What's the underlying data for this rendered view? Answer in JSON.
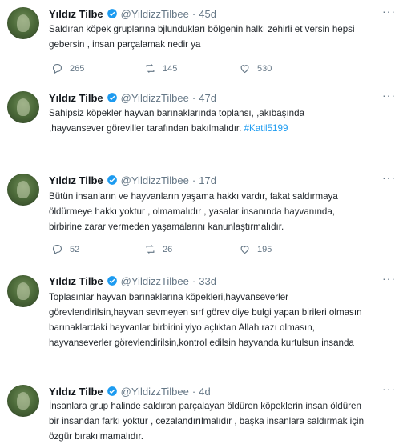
{
  "user": {
    "name": "Yıldız Tilbe",
    "handle": "@YildizzTilbee"
  },
  "tweets": [
    {
      "time": "45d",
      "lines": [
        "Saldıran köpek gruplarına bjlundukları bölgenin halkı zehirli et versin hepsi",
        "gebersin , insan parçalamak nedir ya"
      ],
      "replies": "265",
      "retweets": "145",
      "likes": "530"
    },
    {
      "time": "47d",
      "lines": [
        "Sahipsiz köpekler hayvan barınaklarında toplansı, ,akıbaşında",
        ",hayvansever göreviller tarafından bakılmalıdır."
      ],
      "hashtag": "#Katil5199"
    },
    {
      "time": "17d",
      "lines": [
        "Bütün insanların ve hayvanların yaşama hakkı vardır, fakat saldırmaya",
        "öldürmeye hakkı yoktur , olmamalıdır , yasalar insanında hayvanında,",
        "birbirine zarar vermeden yaşamalarını kanunlaştırmalıdır."
      ],
      "replies": "52",
      "retweets": "26",
      "likes": "195"
    },
    {
      "time": "33d",
      "lines": [
        "Toplasınlar hayvan barınaklarına köpekleri,hayvanseverler",
        "görevlendirilsin,hayvan sevmeyen sırf görev diye bulgi yapan birileri olmasın",
        "barınaklardaki hayvanlar birbirini yiyo açlıktan Allah razı olmasın,",
        "hayvanseverler görevlendirilsin,kontrol edilsin hayvanda kurtulsun insanda"
      ]
    },
    {
      "time": "4d",
      "lines": [
        "İnsanlara grup halinde saldıran parçalayan öldüren köpeklerin insan öldüren",
        "bir insandan farkı yoktur , cezalandırılmalıdır , başka insanlara saldırmak için",
        "özgür bırakılmamalıdır."
      ]
    }
  ],
  "icons": {
    "verified": "verified-badge-icon",
    "more": "more-options-icon",
    "reply": "reply-icon",
    "retweet": "retweet-icon",
    "like": "like-icon"
  },
  "colors": {
    "accent": "#1d9bf0",
    "muted": "#657786",
    "text": "#0f1419"
  },
  "dot": "·",
  "more_glyph": "···"
}
